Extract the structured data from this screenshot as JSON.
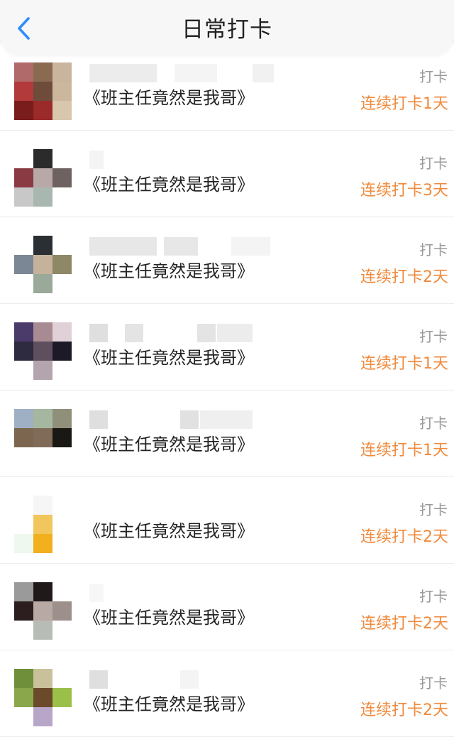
{
  "header": {
    "title": "日常打卡",
    "back_icon": "chevron-left-icon",
    "accent": "#2f8cff"
  },
  "colors": {
    "streak": "#f08a3c",
    "status": "#9a9a9a"
  },
  "items": [
    {
      "book": "《班主任竟然是我哥》",
      "status": "打卡",
      "streak": "连续打卡1天",
      "avatar": [
        "#b06a6a",
        "#8a6b52",
        "#c9b59e",
        "#b23a3a",
        "#6f4b3c",
        "#cbb89c",
        "#7a1c1c",
        "#9b2a2a",
        "#d8c6ad"
      ]
    },
    {
      "book": "《班主任竟然是我哥》",
      "status": "打卡",
      "streak": "连续打卡3天",
      "avatar": [
        "#ffffff",
        "#2b2b2b",
        "#ffffff",
        "#8a3a42",
        "#b9a9a6",
        "#6e6260",
        "#c8c8c8",
        "#a8b8b0",
        "#ffffff"
      ]
    },
    {
      "book": "《班主任竟然是我哥》",
      "status": "打卡",
      "streak": "连续打卡2天",
      "avatar": [
        "#ffffff",
        "#2a2f33",
        "#ffffff",
        "#7b8794",
        "#c4b39a",
        "#8e8866",
        "#ffffff",
        "#9aa99a",
        "#ffffff"
      ]
    },
    {
      "book": "《班主任竟然是我哥》",
      "status": "打卡",
      "streak": "连续打卡1天",
      "avatar": [
        "#4a3b6b",
        "#a88a92",
        "#e0d0d8",
        "#2e2a40",
        "#5e4f5f",
        "#1c1a26",
        "#ffffff",
        "#b3a4ad",
        "#ffffff"
      ]
    },
    {
      "book": "《班主任竟然是我哥》",
      "status": "打卡",
      "streak": "连续打卡1天",
      "avatar": [
        "#9fb0c4",
        "#a5b7a0",
        "#8f8f7a",
        "#7d6650",
        "#806a58",
        "#1a1814",
        "#ffffff",
        "#ffffff",
        "#ffffff"
      ]
    },
    {
      "book": "《班主任竟然是我哥》",
      "status": "打卡",
      "streak": "连续打卡2天",
      "avatar": [
        "#ffffff",
        "#f6f6f6",
        "#ffffff",
        "#ffffff",
        "#f1c65c",
        "#ffffff",
        "#eef8ee",
        "#f2b01e",
        "#ffffff"
      ]
    },
    {
      "book": "《班主任竟然是我哥》",
      "status": "打卡",
      "streak": "连续打卡2天",
      "avatar": [
        "#9a9a9a",
        "#1f1a19",
        "#ffffff",
        "#2c1e1e",
        "#b8a9a4",
        "#9c8f8c",
        "#ffffff",
        "#b7bcb6",
        "#ffffff"
      ]
    },
    {
      "book": "《班主任竟然是我哥》",
      "status": "打卡",
      "streak": "连续打卡2天",
      "avatar": [
        "#6f8f3a",
        "#c8c19a",
        "#ffffff",
        "#8aa84b",
        "#6a4a2a",
        "#9bc04a",
        "#ffffff",
        "#b8a6c8",
        "#ffffff"
      ]
    }
  ]
}
